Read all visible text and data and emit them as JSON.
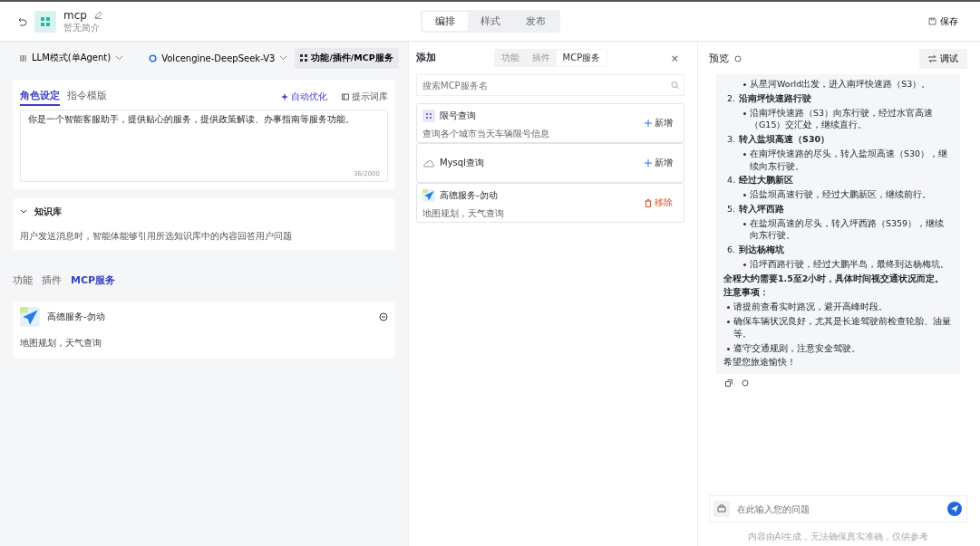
{
  "header": {
    "title": "mcp",
    "subtitle": "暂无简介",
    "tabs": [
      {
        "label": "编排",
        "selected": true
      },
      {
        "label": "样式",
        "selected": false
      },
      {
        "label": "发布",
        "selected": false
      }
    ],
    "save": "保存"
  },
  "config": {
    "mode": "LLM模式(单Agent)",
    "model": "Volcengine-DeepSeek-V3",
    "features_button": "功能/插件/MCP服务",
    "prompt_tabs": [
      {
        "label": "角色设定",
        "selected": true
      },
      {
        "label": "指令模版",
        "selected": false
      }
    ],
    "optimize": "自动优化",
    "library": "提示词库",
    "prompt": "你是一个智能客服助手，提供贴心的服务，提供政策解读、办事指南等服务功能。",
    "count": "36/2000",
    "knowledge": {
      "title": "知识库",
      "expanded": true,
      "description": "用户发送消息时，智能体能够引用所选知识库中的内容回答用户问题"
    },
    "service_tabs": [
      {
        "label": "功能",
        "selected": false
      },
      {
        "label": "插件",
        "selected": false
      },
      {
        "label": "MCP服务",
        "selected": true
      }
    ],
    "services": [
      {
        "name": "高德服务-勿动",
        "description": "地图规划，天气查询"
      }
    ]
  },
  "add_panel": {
    "title": "添加",
    "tabs": [
      {
        "label": "功能",
        "selected": false
      },
      {
        "label": "插件",
        "selected": false
      },
      {
        "label": "MCP服务",
        "selected": true
      }
    ],
    "close": "×",
    "search": {
      "placeholder": "搜索MCP服务名"
    },
    "items": [
      {
        "name": "限号查询",
        "description": "查询各个城市当天车辆限号信息",
        "action": "新增",
        "added": false
      },
      {
        "name": "Mysql查询",
        "action": "新增",
        "added": false
      },
      {
        "name": "高德服务-勿动",
        "description": "地图规划，天气查询",
        "action": "移除",
        "added": true
      }
    ]
  },
  "preview": {
    "title": "预览",
    "debug": "调试",
    "message": [
      {
        "kind": "sub",
        "text": "从星河World出发，进入南坪快速路（S3）。"
      },
      {
        "kind": "step",
        "number": "2.",
        "text": "沿南坪快速路行驶"
      },
      {
        "kind": "sub",
        "text": "沿南坪快速路（S3）向东行驶，经过水官高速（G15）交汇处，继续直行。"
      },
      {
        "kind": "step",
        "number": "3.",
        "text": "转入盐坝高速（S30）"
      },
      {
        "kind": "sub",
        "text": "在南坪快速路的尽头，转入盐坝高速（S30），继续向东行驶。"
      },
      {
        "kind": "step",
        "number": "4.",
        "text": "经过大鹏新区"
      },
      {
        "kind": "sub",
        "text": "沿盐坝高速行驶，经过大鹏新区，继续前行。"
      },
      {
        "kind": "step",
        "number": "5.",
        "text": "转入坪西路"
      },
      {
        "kind": "sub",
        "text": "在盐坝高速的尽头，转入坪西路（S359），继续向东行驶。"
      },
      {
        "kind": "step",
        "number": "6.",
        "text": "到达杨梅坑"
      },
      {
        "kind": "sub",
        "text": "沿坪西路行驶，经过大鹏半岛，最终到达杨梅坑。"
      },
      {
        "kind": "bold",
        "text": "全程大约需要1.5至2小时，具体时间视交通状况而定。"
      },
      {
        "kind": "bold",
        "text": "注意事项："
      },
      {
        "kind": "bullet",
        "text": "请提前查看实时路况，避开高峰时段。"
      },
      {
        "kind": "bullet",
        "text": "确保车辆状况良好，尤其是长途驾驶前检查轮胎、油量等。"
      },
      {
        "kind": "bullet",
        "text": "遵守交通规则，注意安全驾驶。"
      },
      {
        "kind": "para",
        "text": "希望您旅途愉快！"
      }
    ],
    "input": {
      "placeholder": "在此输入您的问题"
    },
    "disclaimer": "内容由AI生成，无法确保真实准确，仅供参考"
  }
}
